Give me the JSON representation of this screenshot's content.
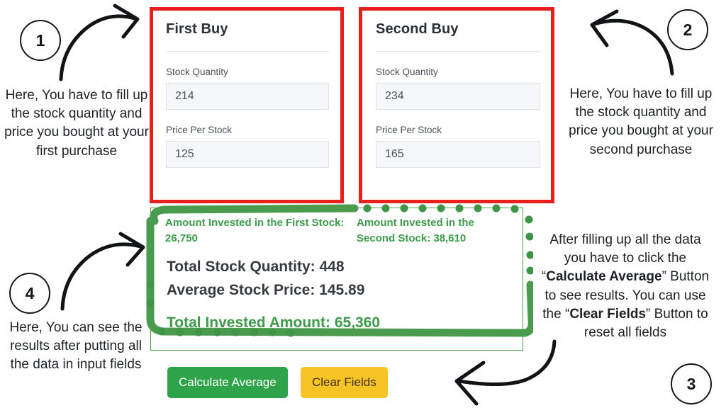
{
  "app": {
    "first_buy": {
      "title": "First Buy",
      "quantity_label": "Stock Quantity",
      "quantity_value": "214",
      "price_label": "Price Per Stock",
      "price_value": "125"
    },
    "second_buy": {
      "title": "Second Buy",
      "quantity_label": "Stock Quantity",
      "quantity_value": "234",
      "price_label": "Price Per Stock",
      "price_value": "165"
    },
    "results": {
      "first_amount": "Amount Invested in the First Stock: 26,750",
      "second_amount": "Amount Invested in the Second Stock: 38,610",
      "total_quantity": "Total Stock Quantity: 448",
      "average_price": "Average Stock Price: 145.89",
      "total_invested": "Total Invested Amount: 65,360"
    },
    "buttons": {
      "calculate_label": "Calculate Average",
      "clear_label": "Clear Fields"
    }
  },
  "annotations": {
    "badge_1": "1",
    "badge_2": "2",
    "badge_3": "3",
    "badge_4": "4",
    "text_1": "Here, You have to fill up the stock quantity and price you bought at your first purchase",
    "text_2": "Here, You have to fill up the stock quantity and price you bought at your second purchase",
    "text_3_part_1": "After filling up all the data you have to click the “",
    "text_3_bold_1": "Calculate Average",
    "text_3_part_2": "” Button to see results. You can use the “",
    "text_3_bold_2": "Clear Fields",
    "text_3_part_3": "” Button to reset all fields",
    "text_4": "Here, You can see the results after putting all the data in input fields"
  },
  "colors": {
    "red_highlight": "#e8201b",
    "green_highlight": "#4e9e50",
    "result_green": "#3d9b4a",
    "button_green": "#2fa34a",
    "button_amber": "#f7c325",
    "text_dark": "#2f3437"
  }
}
